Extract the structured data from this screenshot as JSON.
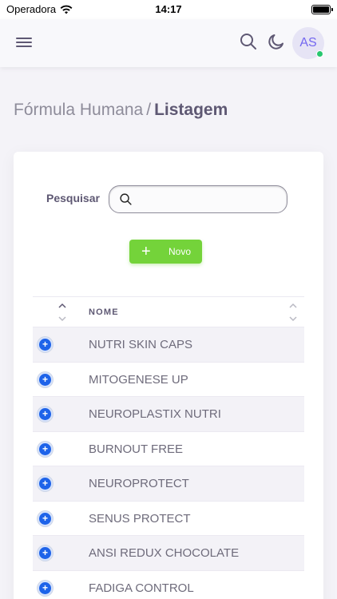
{
  "status_bar": {
    "carrier": "Operadora",
    "time": "14:17"
  },
  "navbar": {
    "avatar_initials": "AS"
  },
  "breadcrumb": {
    "parent": "Fórmula Humana",
    "separator": "/",
    "current": "Listagem"
  },
  "search": {
    "label": "Pesquisar",
    "value": "",
    "placeholder": ""
  },
  "new_button": {
    "plus": "+",
    "label": "Novo"
  },
  "table": {
    "column_name": "NOME",
    "rows": [
      {
        "expand": "+",
        "name": "NUTRI SKIN CAPS"
      },
      {
        "expand": "+",
        "name": "MITOGENESE UP"
      },
      {
        "expand": "+",
        "name": "NEUROPLASTIX NUTRI"
      },
      {
        "expand": "+",
        "name": "BURNOUT FREE"
      },
      {
        "expand": "+",
        "name": "NEUROPROTECT"
      },
      {
        "expand": "+",
        "name": "SENUS PROTECT"
      },
      {
        "expand": "+",
        "name": "ANSI REDUX CHOCOLATE"
      },
      {
        "expand": "+",
        "name": "FADIGA CONTROL"
      }
    ]
  },
  "icons": {
    "menu": "hamburger-menu-icon",
    "search": "search-icon",
    "theme": "moon-icon",
    "sort": "sort-chevrons-icon",
    "expand": "plus-circle-icon"
  },
  "colors": {
    "accent": "#7367f0",
    "success": "#74d33a",
    "online": "#28c76f",
    "expand_button": "#1e63e9"
  }
}
